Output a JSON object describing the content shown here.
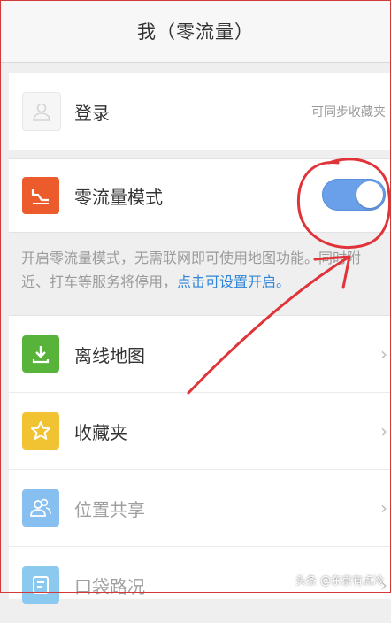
{
  "header": {
    "title": "我（零流量）"
  },
  "login": {
    "label": "登录",
    "hint": "可同步收藏夹",
    "icon": "user-icon"
  },
  "zero_traffic": {
    "label": "零流量模式",
    "icon": "zero-traffic-icon",
    "toggle_on": true,
    "toggle_color": "#6aa0ea",
    "desc_text": "开启零流量模式，无需联网即可使用地图功能。同时附近、打车等服务将停用，",
    "desc_link": "点击可设置开启。"
  },
  "menu": {
    "items": [
      {
        "label": "离线地图",
        "icon": "download-icon",
        "color": "#57b33a",
        "enabled": true
      },
      {
        "label": "收藏夹",
        "icon": "star-icon",
        "color": "#f1c232",
        "enabled": true
      },
      {
        "label": "位置共享",
        "icon": "people-icon",
        "color": "#86bff0",
        "enabled": false
      },
      {
        "label": "口袋路况",
        "icon": "traffic-icon",
        "color": "#8cc9ee",
        "enabled": false
      }
    ]
  },
  "watermark": "头条 @东京有点冷"
}
